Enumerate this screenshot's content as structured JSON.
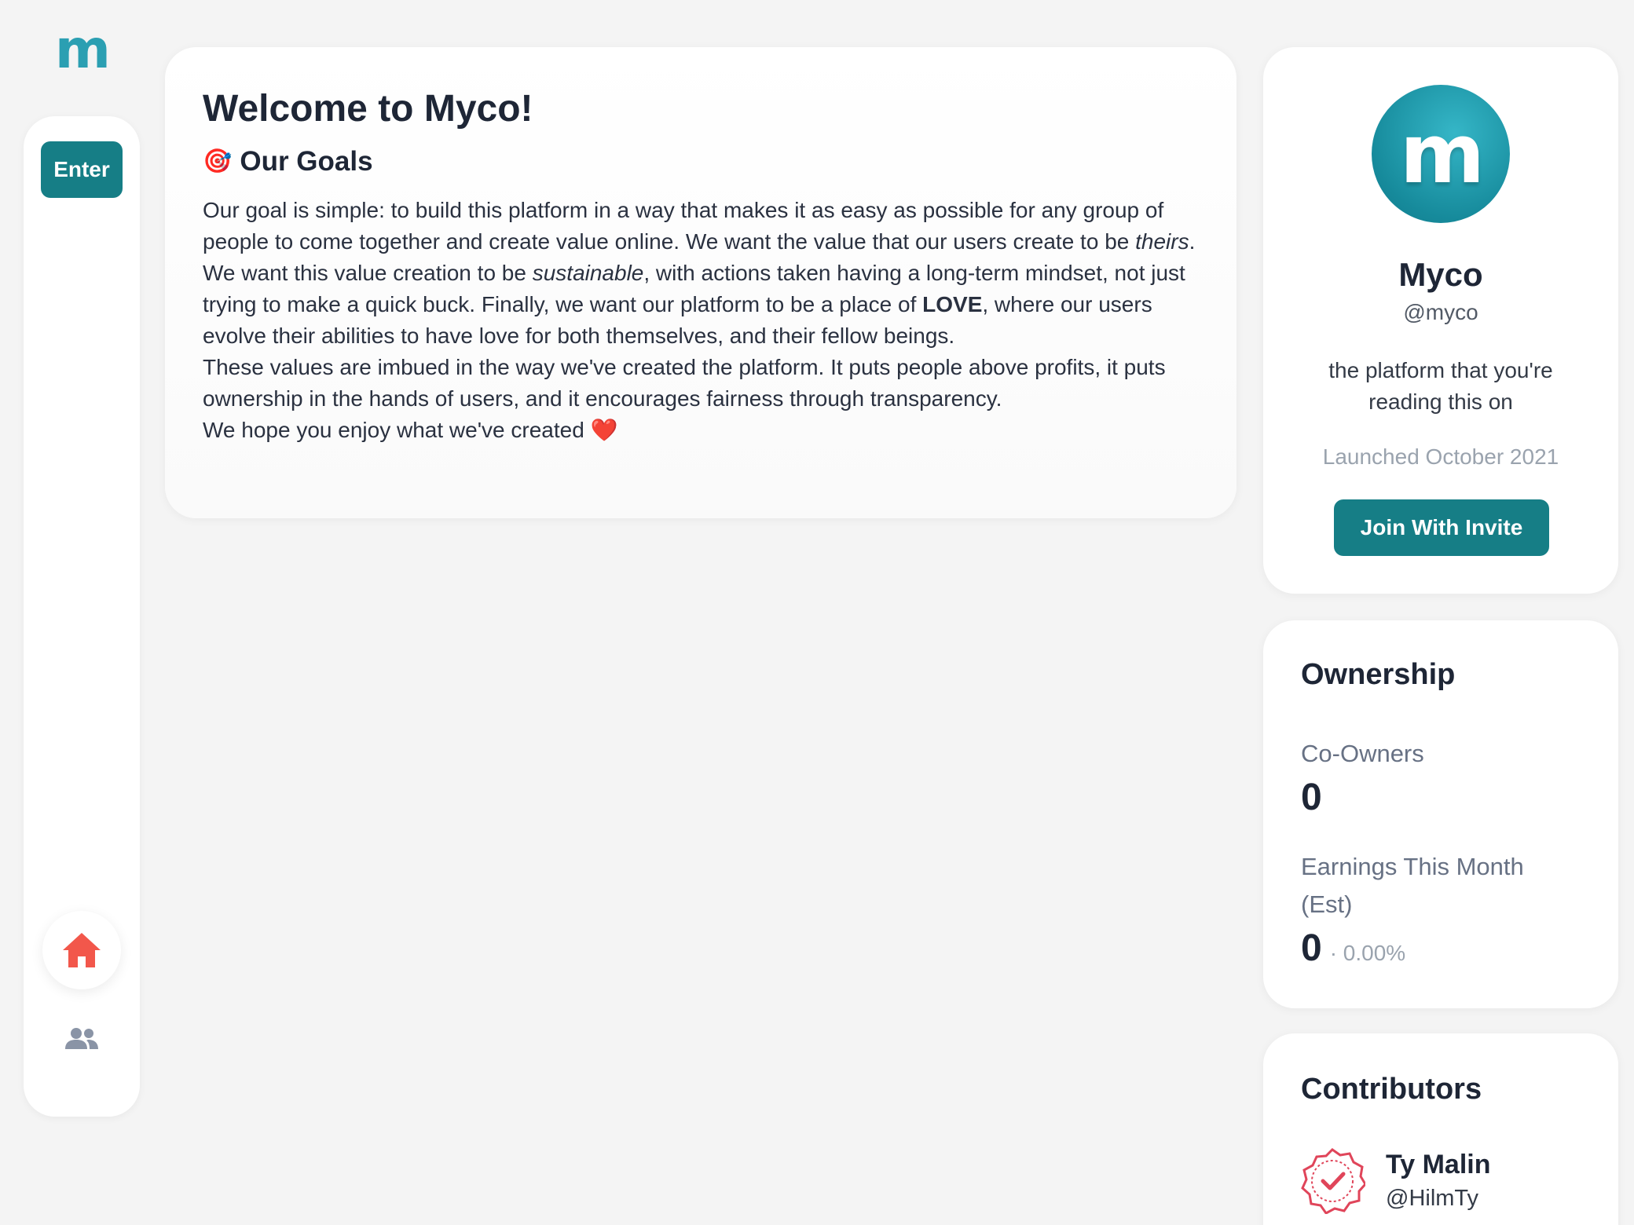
{
  "brand": {
    "logo_letter": "m"
  },
  "sidebar": {
    "enter_label": "Enter",
    "home_icon": "home-icon",
    "users_icon": "users-icon"
  },
  "main": {
    "title": "Welcome to Myco!",
    "goals_heading": "Our Goals",
    "goals_emoji": "🎯",
    "paragraph1": {
      "part1": "Our goal is simple: to build this platform in a way that makes it as easy as possible for any group of people to come together and create value online. We want the value that our users create to be ",
      "em1": "theirs",
      "part2": ". We want this value creation to be ",
      "em2": "sustainable",
      "part3": ", with actions taken having a long-term mindset, not just trying to make a quick buck. Finally, we want our platform to be a place of ",
      "strong1": "LOVE",
      "part4": ", where our users evolve their abilities to have love for both themselves, and their fellow beings."
    },
    "paragraph2": "These values are imbued in the way we've created the platform. It puts people above profits, it puts ownership in the hands of users, and it encourages fairness through transparency.",
    "paragraph3": "We hope you enjoy what we've created",
    "paragraph3_emoji": "❤️"
  },
  "profile": {
    "avatar_letter": "m",
    "name": "Myco",
    "handle": "@myco",
    "description": "the platform that you're reading this on",
    "launched": "Launched October 2021",
    "join_label": "Join With Invite"
  },
  "ownership": {
    "title": "Ownership",
    "co_owners_label": "Co-Owners",
    "co_owners_value": "0",
    "earnings_label": "Earnings This Month (Est)",
    "earnings_value": "0",
    "earnings_pct": "· 0.00%"
  },
  "contributors": {
    "title": "Contributors",
    "items": [
      {
        "name": "Ty Malin",
        "handle": "@HilmTy",
        "badge_icon": "verified-badge-icon"
      }
    ]
  },
  "colors": {
    "accent": "#167e86",
    "brand": "#2b9fb2",
    "home_icon": "#f2574b",
    "users_icon": "#8a94a6",
    "badge": "#e0455a"
  }
}
